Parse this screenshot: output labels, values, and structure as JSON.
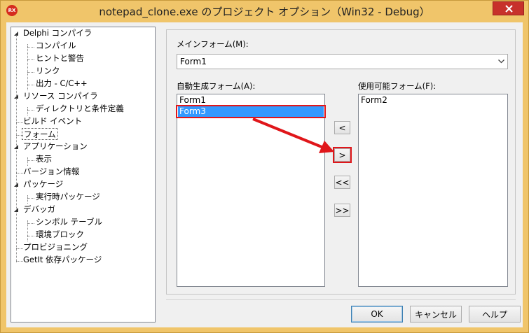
{
  "window": {
    "title": "notepad_clone.exe のプロジェクト オプション（Win32 - Debug）",
    "app_icon_text": "RX"
  },
  "tree": {
    "items": [
      {
        "label": "Delphi コンパイラ"
      },
      {
        "label": "コンパイル"
      },
      {
        "label": "ヒントと警告"
      },
      {
        "label": "リンク"
      },
      {
        "label": "出力 - C/C++"
      },
      {
        "label": "リソース コンパイラ"
      },
      {
        "label": "ディレクトリと条件定義"
      },
      {
        "label": "ビルド イベント"
      },
      {
        "label": "フォーム"
      },
      {
        "label": "アプリケーション"
      },
      {
        "label": "表示"
      },
      {
        "label": "バージョン情報"
      },
      {
        "label": "パッケージ"
      },
      {
        "label": "実行時パッケージ"
      },
      {
        "label": "デバッガ"
      },
      {
        "label": "シンボル テーブル"
      },
      {
        "label": "環境ブロック"
      },
      {
        "label": "プロビジョニング"
      },
      {
        "label": "GetIt 依存パッケージ"
      }
    ]
  },
  "main_form": {
    "label": "メインフォーム(M):",
    "value": "Form1"
  },
  "auto_create": {
    "label": "自動生成フォーム(A):",
    "items": [
      "Form1",
      "Form3"
    ]
  },
  "available": {
    "label": "使用可能フォーム(F):",
    "items": [
      "Form2"
    ]
  },
  "move_buttons": {
    "move_left": "<",
    "move_right": ">",
    "move_all_left": "<<",
    "move_all_right": ">>"
  },
  "buttons": {
    "ok": "OK",
    "cancel": "キャンセル",
    "help": "ヘルプ"
  },
  "colors": {
    "selection": "#3399ff",
    "annotation": "#e0161a",
    "title_bar": "#f0c56a"
  },
  "icons": [
    "app-icon",
    "close-icon",
    "chevron-down-icon",
    "collapse-triangle-icon",
    "red-arrow-icon"
  ]
}
